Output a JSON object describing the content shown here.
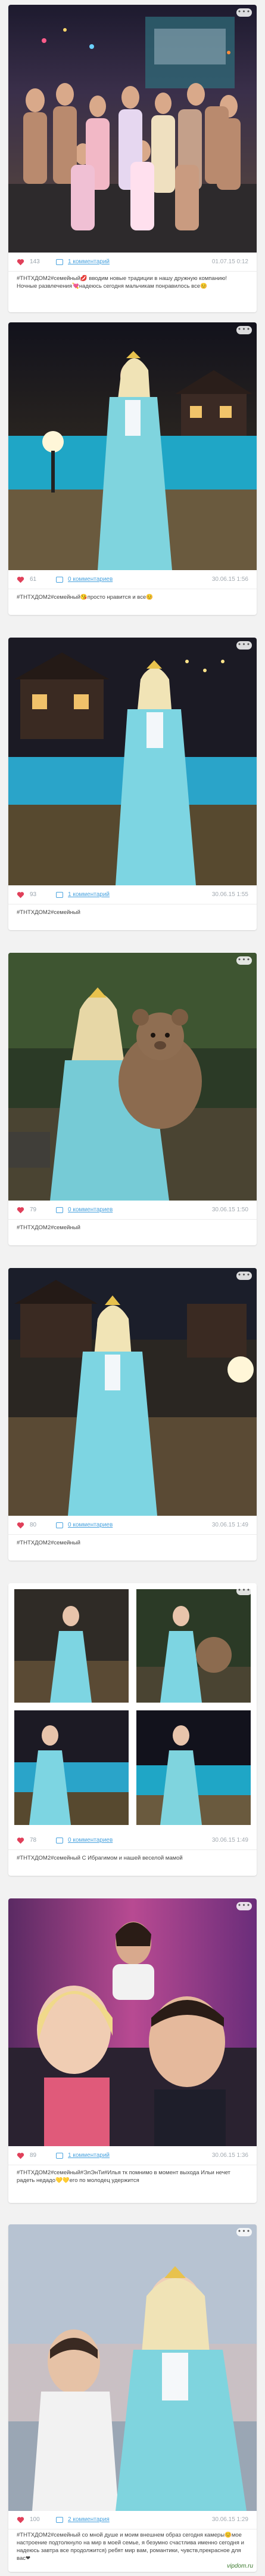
{
  "site": {
    "watermark": "vipdom.ru"
  },
  "icons": {
    "like": "heart-icon",
    "comment": "comment-icon",
    "more": "more-options-icon"
  },
  "colors": {
    "heart": "#e0405a",
    "link": "#4aa3df",
    "muted": "#9aa4ad",
    "background": "#f2f2f2"
  },
  "posts": [
    {
      "photo_alt": "group photo",
      "likes": "143",
      "comments_label": "1 комментарий",
      "date": "01.07.15 0:12",
      "caption": "#ТНТХДОМ2#семейный💋 вводим новые традиции в нашу дружную компанию! Ночные развлечения💘надеюсь сегодня мальчикам понравилось все😊"
    },
    {
      "photo_alt": "woman in blue dress by pool",
      "likes": "61",
      "comments_label": "0 комментариев",
      "date": "30.06.15 1:56",
      "caption": "#ТНТХДОМ2#семейный😘просто нравится и все😊"
    },
    {
      "photo_alt": "woman in blue dress at night",
      "likes": "93",
      "comments_label": "1 комментарий",
      "date": "30.06.15 1:55",
      "caption": "#ТНТХДОМ2#семейный"
    },
    {
      "photo_alt": "woman with teddy bear",
      "likes": "79",
      "comments_label": "0 комментариев",
      "date": "30.06.15 1:50",
      "caption": "#ТНТХДОМ2#семейный"
    },
    {
      "photo_alt": "woman in crown and blue dress",
      "likes": "80",
      "comments_label": "0 комментариев",
      "date": "30.06.15 1:49",
      "caption": "#ТНТХДОМ2#семейный"
    },
    {
      "photo_alt": "collage of four photos",
      "likes": "78",
      "comments_label": "0 комментариев",
      "date": "30.06.15 1:49",
      "caption": "#ТНТХДОМ2#семейный С Ибрагимом и нашей веселой мамой"
    },
    {
      "photo_alt": "selfie with three people",
      "likes": "89",
      "comments_label": "1 комментарий",
      "date": "30.06.15 1:36",
      "caption": "#ТНТХДОМ2#семейный#ЭлЭнТи#Илья тк помнимо в момент выхода Ильи нечет радеть недадо💛💛его по молодец удержится"
    },
    {
      "photo_alt": "man and woman in crown",
      "likes": "100",
      "comments_label": "2 комментария",
      "date": "30.06.15 1:29",
      "caption": "#ТНТХДОМ2#семейный со мной душе и моим внешнем образ сегодня камеры😊мое настроение подтолкнуло на мир в моей семье, я безумно счастлива именно сегодня и надеюсь завтра все продолжится) ребят мир вам, романтики, чувств,прекрасное для вас❤"
    }
  ]
}
